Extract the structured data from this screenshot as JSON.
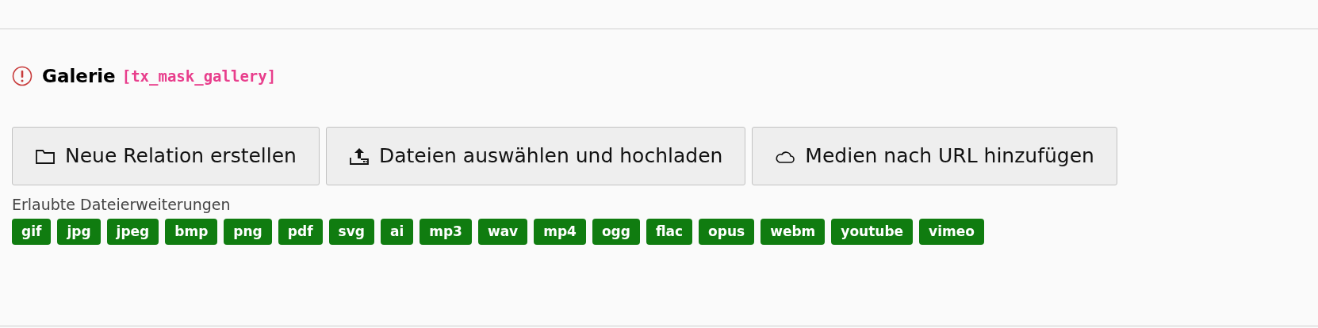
{
  "field": {
    "label": "Galerie",
    "identifier": "[tx_mask_gallery]"
  },
  "buttons": [
    {
      "kind": "folder",
      "label": "Neue Relation erstellen"
    },
    {
      "kind": "upload",
      "label": "Dateien auswählen und hochladen"
    },
    {
      "kind": "cloud",
      "label": "Medien nach URL hinzufügen"
    }
  ],
  "allowed_label": "Erlaubte Dateierweiterungen",
  "extensions": [
    "gif",
    "jpg",
    "jpeg",
    "bmp",
    "png",
    "pdf",
    "svg",
    "ai",
    "mp3",
    "wav",
    "mp4",
    "ogg",
    "flac",
    "opus",
    "webm",
    "youtube",
    "vimeo"
  ]
}
